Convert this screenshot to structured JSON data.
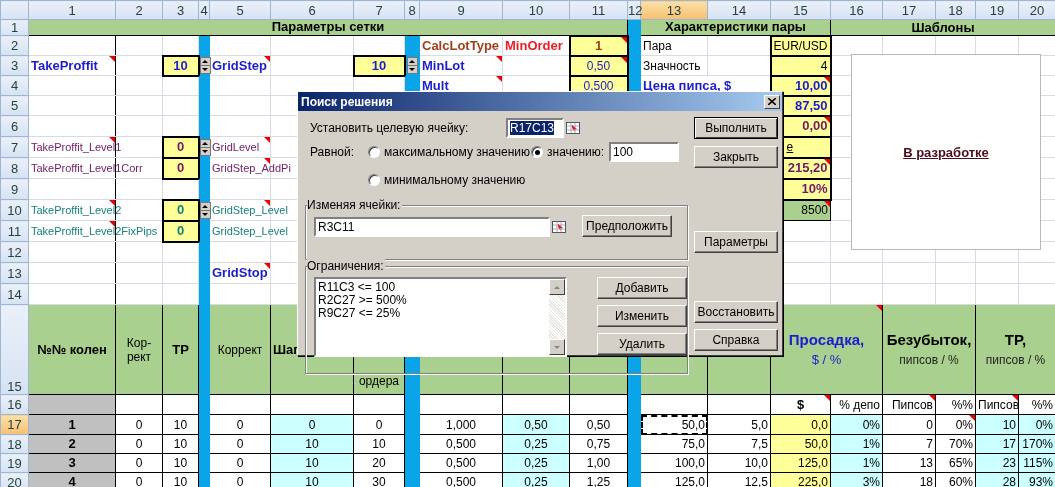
{
  "columns": [
    {
      "label": "1",
      "selected": false
    },
    {
      "label": "2",
      "selected": false
    },
    {
      "label": "3",
      "selected": false
    },
    {
      "label": "4",
      "selected": false
    },
    {
      "label": "5",
      "selected": false
    },
    {
      "label": "6",
      "selected": false
    },
    {
      "label": "7",
      "selected": false
    },
    {
      "label": "8",
      "selected": false
    },
    {
      "label": "9",
      "selected": false
    },
    {
      "label": "10",
      "selected": false
    },
    {
      "label": "11",
      "selected": false
    },
    {
      "label": "12",
      "selected": false
    },
    {
      "label": "13",
      "selected": true
    },
    {
      "label": "14",
      "selected": false
    },
    {
      "label": "15",
      "selected": false
    },
    {
      "label": "16",
      "selected": false
    },
    {
      "label": "17",
      "selected": false
    },
    {
      "label": "18",
      "selected": false
    },
    {
      "label": "19",
      "selected": false
    },
    {
      "label": "20",
      "selected": false
    }
  ],
  "rows": [
    {
      "header": "1",
      "selected": false,
      "cells": {
        "c1": {
          "text": "Параметры сетки"
        },
        "c13": {
          "text": "Характеристики пары"
        },
        "c16": {
          "text": "Шаблоны"
        }
      }
    },
    {
      "header": "2",
      "selected": false,
      "cells": {
        "c9": {
          "text": "CalcLotType"
        },
        "c10": {
          "text": "MinOrder"
        },
        "c11": {
          "text": "1",
          "note": true
        },
        "c13": {
          "text": "Пара"
        },
        "c15": {
          "text": "EUR/USD"
        }
      }
    },
    {
      "header": "3",
      "selected": false,
      "cells": {
        "c1": {
          "text": "TakeProffit",
          "note": true
        },
        "c3": {
          "text": "10"
        },
        "c4": {
          "kind": "spinner"
        },
        "c5": {
          "text": "GridStep",
          "note": true
        },
        "c7": {
          "text": "10"
        },
        "c8": {
          "kind": "spinner"
        },
        "c9": {
          "text": "MinLot",
          "note": true
        },
        "c11": {
          "text": "0,50",
          "note": true
        },
        "c13": {
          "text": "Значность"
        },
        "c15": {
          "text": "4"
        }
      }
    },
    {
      "header": "4",
      "selected": false,
      "cells": {
        "c9": {
          "text": "Mult",
          "note": true
        },
        "c11": {
          "text": "0,500"
        },
        "c13": {
          "text": "Цена пипса, $"
        },
        "c15": {
          "text": "10,00",
          "note": true
        }
      }
    },
    {
      "header": "5",
      "selected": false,
      "cells": {
        "c15": {
          "text": "87,50"
        }
      }
    },
    {
      "header": "6",
      "selected": false,
      "cells": {
        "c15": {
          "text": "0,00",
          "note": true
        }
      }
    },
    {
      "header": "7",
      "selected": false,
      "cells": {
        "c1": {
          "text": "TakeProffit_Level1",
          "note": true
        },
        "c3": {
          "text": "0"
        },
        "c4": {
          "kind": "spinner"
        },
        "c5": {
          "text": "GridLevel",
          "note": true
        },
        "c15": {
          "text": "е"
        }
      }
    },
    {
      "header": "8",
      "selected": false,
      "cells": {
        "c1": {
          "text": "TakeProffit_Level1Corr"
        },
        "c3": {
          "text": "0"
        },
        "c5": {
          "text": "GridStep_AddPi",
          "note": true
        },
        "c15": {
          "text": "215,20",
          "note": true
        }
      }
    },
    {
      "header": "9",
      "selected": false,
      "cells": {
        "c15": {
          "text": "10%"
        }
      }
    },
    {
      "header": "10",
      "selected": false,
      "cells": {
        "c1": {
          "text": "TakeProffit_Level2",
          "note": true
        },
        "c3": {
          "text": "0"
        },
        "c4": {
          "kind": "spinner"
        },
        "c5": {
          "text": "GridStep_Level",
          "note": true
        },
        "c15": {
          "text": "8500",
          "note": true
        }
      }
    },
    {
      "header": "11",
      "selected": false,
      "cells": {
        "c1": {
          "text": "TakeProffit_Level2FixPips",
          "note": true
        },
        "c3": {
          "text": "0"
        },
        "c5": {
          "text": "GridStep_Level"
        }
      }
    },
    {
      "header": "12",
      "selected": false,
      "cells": {}
    },
    {
      "header": "13",
      "selected": false,
      "cells": {
        "c5": {
          "text": "GridStop",
          "note": true
        }
      }
    },
    {
      "header": "14",
      "selected": false,
      "cells": {}
    },
    {
      "header": "15",
      "selected": false,
      "cells": {
        "c1": {
          "text": "№№ колен"
        },
        "c2": {
          "text": "Кор-\nрект"
        },
        "c3": {
          "text": "TP"
        },
        "c5": {
          "text": "Коррект"
        },
        "c6": {
          "text": "Шаг"
        },
        "c7": {
          "text": "ордера"
        },
        "c15": {
          "text": "Просадка,",
          "subtext": "$ / %",
          "note": true
        },
        "c17": {
          "text": "Безубыток,",
          "subtext": "пипсов / %"
        },
        "c19": {
          "text": "TP,",
          "subtext": "пипсов / %"
        }
      }
    },
    {
      "header": "16",
      "selected": false,
      "cells": {
        "c15": {
          "text": "$",
          "note": true
        },
        "c16": {
          "text": "% депо"
        },
        "c17": {
          "text": "Пипсов",
          "note": true
        },
        "c18": {
          "text": "%%"
        },
        "c19": {
          "text": "Пипсов",
          "note": true
        },
        "c20": {
          "text": "%%"
        }
      }
    },
    {
      "header": "17",
      "selected": true,
      "cells": {
        "c1": {
          "text": "1"
        },
        "c2": {
          "text": "0"
        },
        "c3": {
          "text": "10"
        },
        "c5": {
          "text": "0"
        },
        "c6": {
          "text": "0"
        },
        "c7": {
          "text": "0"
        },
        "c9": {
          "text": "1,000"
        },
        "c10": {
          "text": "0,50"
        },
        "c11": {
          "text": "0,50"
        },
        "c13": {
          "text": "50,0",
          "marquee": true
        },
        "c14": {
          "text": "5,0"
        },
        "c15": {
          "text": "0,0"
        },
        "c16": {
          "text": "0%"
        },
        "c17": {
          "text": "0"
        },
        "c18": {
          "text": "0%",
          "note": true
        },
        "c19": {
          "text": "10"
        },
        "c20": {
          "text": "0%"
        }
      }
    },
    {
      "header": "18",
      "selected": false,
      "cells": {
        "c1": {
          "text": "2"
        },
        "c2": {
          "text": "0"
        },
        "c3": {
          "text": "10"
        },
        "c5": {
          "text": "0"
        },
        "c6": {
          "text": "10"
        },
        "c7": {
          "text": "10"
        },
        "c9": {
          "text": "0,500"
        },
        "c10": {
          "text": "0,25"
        },
        "c11": {
          "text": "0,75"
        },
        "c13": {
          "text": "75,0"
        },
        "c14": {
          "text": "7,5"
        },
        "c15": {
          "text": "50,0"
        },
        "c16": {
          "text": "1%"
        },
        "c17": {
          "text": "7"
        },
        "c18": {
          "text": "70%"
        },
        "c19": {
          "text": "17"
        },
        "c20": {
          "text": "170%"
        }
      }
    },
    {
      "header": "19",
      "selected": false,
      "cells": {
        "c1": {
          "text": "3"
        },
        "c2": {
          "text": "0"
        },
        "c3": {
          "text": "10"
        },
        "c5": {
          "text": "0"
        },
        "c6": {
          "text": "10"
        },
        "c7": {
          "text": "20"
        },
        "c9": {
          "text": "0,500"
        },
        "c10": {
          "text": "0,25"
        },
        "c11": {
          "text": "1,00"
        },
        "c13": {
          "text": "100,0"
        },
        "c14": {
          "text": "10,0"
        },
        "c15": {
          "text": "125,0"
        },
        "c16": {
          "text": "1%"
        },
        "c17": {
          "text": "13"
        },
        "c18": {
          "text": "65%"
        },
        "c19": {
          "text": "23"
        },
        "c20": {
          "text": "115%"
        }
      }
    },
    {
      "header": "20",
      "selected": false,
      "cells": {
        "c1": {
          "text": "4"
        },
        "c2": {
          "text": "0"
        },
        "c3": {
          "text": "10"
        },
        "c5": {
          "text": "0"
        },
        "c6": {
          "text": "10"
        },
        "c7": {
          "text": "30"
        },
        "c9": {
          "text": "0,500"
        },
        "c10": {
          "text": "0,25"
        },
        "c11": {
          "text": "1,25"
        },
        "c13": {
          "text": "125,0"
        },
        "c14": {
          "text": "12,5"
        },
        "c15": {
          "text": "225,0"
        },
        "c16": {
          "text": "3%"
        },
        "c17": {
          "text": "18"
        },
        "c18": {
          "text": "60%"
        },
        "c19": {
          "text": "28"
        },
        "c20": {
          "text": "93%"
        }
      }
    }
  ],
  "template_panel": {
    "text": "В разработке"
  },
  "dialog": {
    "title": "Поиск решения",
    "target_label": "Установить целевую ячейку:",
    "target_value": "R17C13",
    "target_value_highlighted": true,
    "equal_label": "Равной:",
    "options": [
      {
        "label": "максимальному значению",
        "selected": false
      },
      {
        "label": "значению:",
        "selected": true
      },
      {
        "label": "минимальному значению",
        "selected": false
      }
    ],
    "value_field": "100",
    "changing_label": "Изменяя ячейки:",
    "changing_value": "R3C11",
    "guess_button": "Предположить",
    "constraints_label": "Ограничения:",
    "constraints": [
      "R11C3 <= 100",
      "R2C27 >= 500%",
      "R9C27 <= 25%"
    ],
    "constraint_buttons": [
      "Добавить",
      "Изменить",
      "Удалить"
    ],
    "side_buttons": [
      {
        "label": "Выполнить",
        "default": true
      },
      {
        "label": "Закрыть",
        "default": false
      },
      {
        "label": "Параметры",
        "default": false
      },
      {
        "label": "Восстановить",
        "default": false
      },
      {
        "label": "Справка",
        "default": false
      }
    ]
  }
}
